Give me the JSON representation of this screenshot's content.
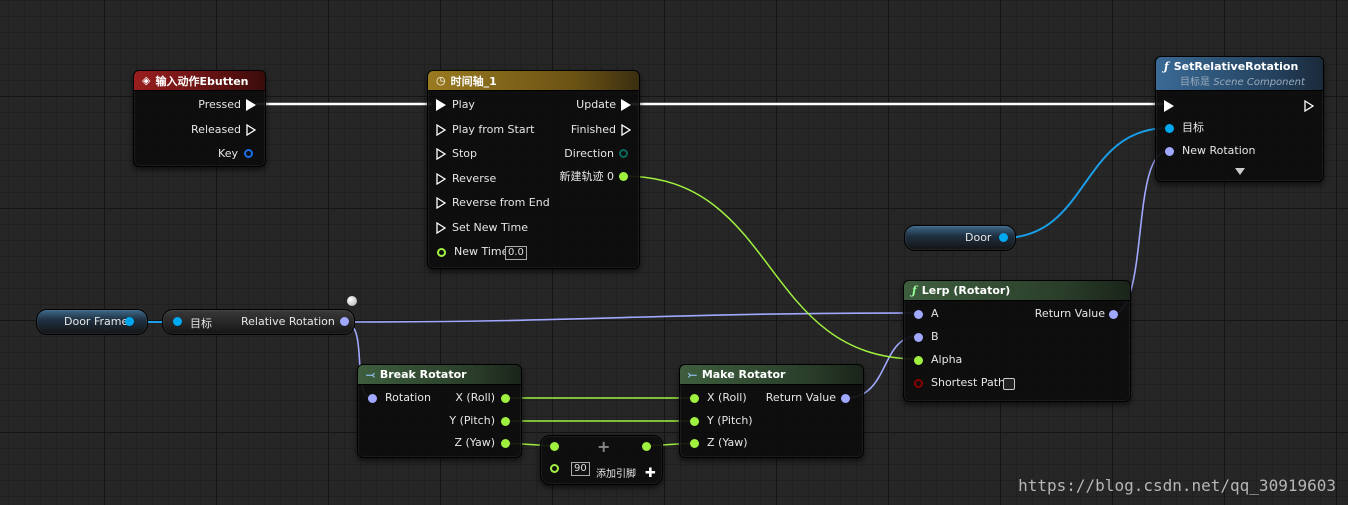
{
  "nodes": {
    "input": {
      "title": "输入动作Ebutten",
      "pins": {
        "pressed": "Pressed",
        "released": "Released",
        "key": "Key"
      }
    },
    "timeline": {
      "title": "时间轴_1",
      "in": [
        "Play",
        "Play from Start",
        "Stop",
        "Reverse",
        "Reverse from End",
        "Set New Time"
      ],
      "new_time": "New Time",
      "new_time_value": "0.0",
      "out": {
        "update": "Update",
        "finished": "Finished",
        "direction": "Direction",
        "track": "新建轨迹 0"
      }
    },
    "set_rot": {
      "title": "SetRelativeRotation",
      "subtitle_prefix": "目标是 ",
      "subtitle_target": "Scene Component",
      "target": "目标",
      "new_rotation": "New Rotation"
    },
    "door": {
      "label": "Door"
    },
    "door_frame": {
      "label": "Door Frame"
    },
    "rel_rot": {
      "target": "目标",
      "output": "Relative Rotation"
    },
    "lerp": {
      "title": "Lerp (Rotator)",
      "a": "A",
      "b": "B",
      "alpha": "Alpha",
      "shortest": "Shortest Path",
      "return": "Return Value"
    },
    "break": {
      "title": "Break Rotator",
      "rotation": "Rotation",
      "x": "X (Roll)",
      "y": "Y (Pitch)",
      "z": "Z (Yaw)"
    },
    "make": {
      "title": "Make Rotator",
      "x": "X (Roll)",
      "y": "Y (Pitch)",
      "z": "Z (Yaw)",
      "return": "Return Value"
    },
    "add": {
      "value": "90",
      "add_pin": "添加引脚"
    }
  },
  "watermark": "https://blog.csdn.net/qq_30919603",
  "colors": {
    "exec": "#ffffff",
    "object": "#00a8f0",
    "rotator": "#a0a8ff",
    "float": "#a0f040",
    "bool": "#8a0000",
    "event_header": "#8a1c1c",
    "timeline_header": "#8a6a1a",
    "function_header": "#2a5a80",
    "pure_header": "#3a5a3a"
  }
}
